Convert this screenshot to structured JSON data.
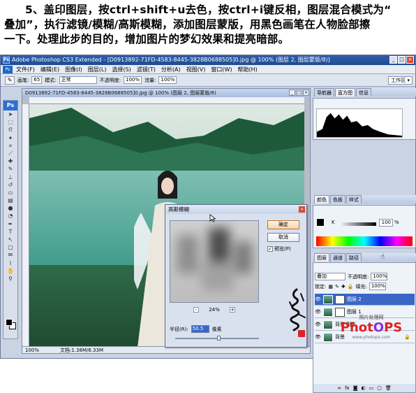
{
  "tutorial": {
    "line1": "5、盖印图层，按ctrl+shift+u去色，按ctrl+i键反相，图层混合模式为“",
    "line2": "叠加”，执行滤镜/模糊/高斯模糊，添加图层蒙版，用黑色画笔在人物脸部擦",
    "line3": "一下。处理此步的目的，增加图片的梦幻效果和提亮暗部。"
  },
  "window": {
    "title": "Adobe Photoshop CS3 Extended - [D0913892-71FD-4583-8445-3828B0688505]0.jpg @ 100% (图层 2, 图层蒙版/8)]",
    "minimize": "_",
    "maximize": "□",
    "close": "×"
  },
  "menu": [
    "文件(F)",
    "编辑(E)",
    "图像(I)",
    "图层(L)",
    "选择(S)",
    "滤镜(T)",
    "分析(A)",
    "视图(V)",
    "窗口(W)",
    "帮助(H)"
  ],
  "options": {
    "brush_label": "画笔:",
    "brush_size": "65",
    "mode_label": "模式:",
    "mode_value": "正常",
    "opacity_label": "不透明度:",
    "opacity_value": "100%",
    "flow_label": "流量:",
    "flow_value": "100%",
    "workspace": "工作区 ▾"
  },
  "toolbox": {
    "logo": "Ps"
  },
  "document": {
    "title": "D0913892-71FD-4583-8445-3828B0688505]0.jpg @ 100% (图层 2, 图层蒙版/8)",
    "zoom": "100%",
    "doc_size": "文档:1.38M/6.33M"
  },
  "gauss_dialog": {
    "title": "高斯模糊",
    "ok": "确定",
    "cancel": "取消",
    "preview_label": "预览(P)",
    "preview_checked": "✓",
    "zoom_minus": "-",
    "zoom_value": "24%",
    "zoom_plus": "+",
    "radius_label": "半径(R):",
    "radius_value": "50.5",
    "radius_unit": "像素"
  },
  "panels": {
    "nav_tabs": [
      "导航器",
      "直方图",
      "信息"
    ],
    "color_tabs": [
      "颜色",
      "色板",
      "样式"
    ],
    "k_label": "K",
    "k_value": "100",
    "k_unit": "%",
    "layers_tabs": [
      "图层",
      "通道",
      "路径"
    ],
    "blend_mode": "叠加",
    "opacity_label": "不透明度:",
    "opacity_value": "100%",
    "lock_label": "锁定:",
    "fill_label": "填充:",
    "fill_value": "100%",
    "layers": [
      {
        "name": "图层 2",
        "visible": "👁",
        "active": true
      },
      {
        "name": "图层 1",
        "visible": "👁",
        "active": false
      },
      {
        "name": "背景 副本",
        "visible": "👁",
        "active": false
      },
      {
        "name": "背景",
        "visible": "👁",
        "active": false,
        "locked": "🔒"
      }
    ],
    "bottom_icons": [
      "∞",
      "fx",
      "◙",
      "◐",
      "▭",
      "▢",
      "🗑"
    ]
  },
  "watermark": {
    "site": "照片处理网",
    "logo_a": "Phot",
    "logo_o": "O",
    "logo_b": "PS",
    "url": "www.photops.com"
  },
  "colors": {
    "accent_blue": "#3a67c7",
    "title_blue": "#2f5ea9",
    "watermark_red": "#e02020",
    "watermark_purple": "#8a2be2"
  }
}
